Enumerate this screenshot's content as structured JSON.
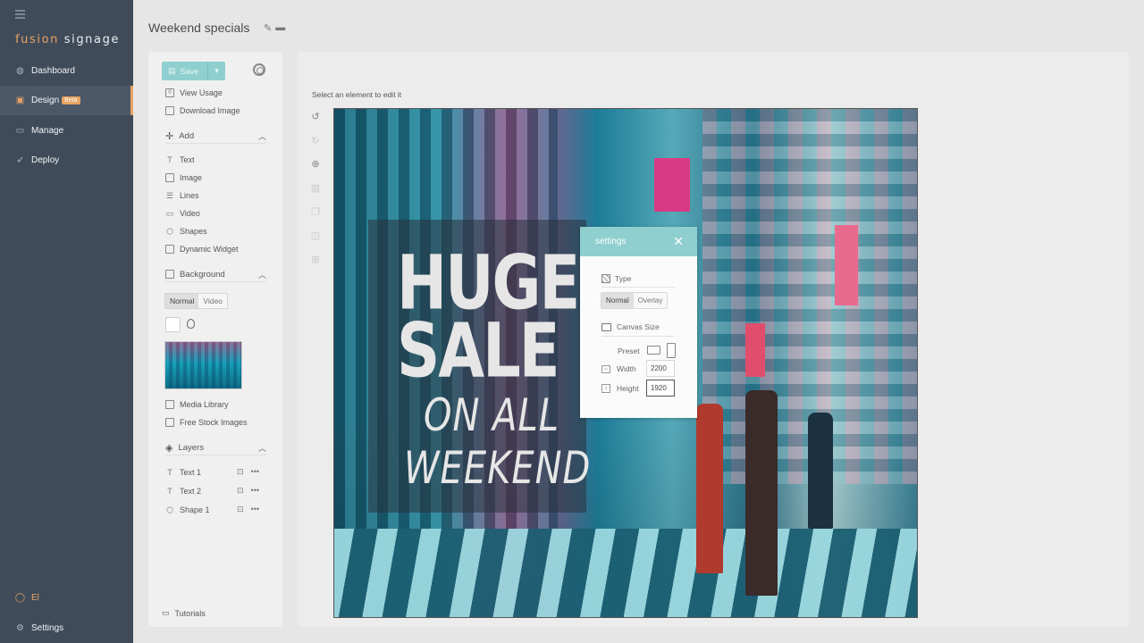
{
  "sidebar": {
    "brand_word1": "fusion",
    "brand_word2": "signage",
    "nav": [
      {
        "label": "Dashboard",
        "icon": "globe-icon"
      },
      {
        "label": "Design",
        "badge": "Beta",
        "icon": "paint-icon"
      },
      {
        "label": "Manage",
        "icon": "folder-icon"
      },
      {
        "label": "Deploy",
        "icon": "rocket-icon"
      }
    ],
    "user_label": "El",
    "settings_label": "Settings"
  },
  "header": {
    "title": "Weekend specials"
  },
  "toolbar": {
    "save_label": "Save",
    "view_usage_label": "View Usage",
    "download_image_label": "Download Image"
  },
  "add_section": {
    "title": "Add",
    "items": [
      "Text",
      "Image",
      "Lines",
      "Video",
      "Shapes",
      "Dynamic Widget"
    ]
  },
  "background_section": {
    "title": "Background",
    "modes": [
      "Normal",
      "Video"
    ],
    "active_mode": "Normal",
    "media_library_label": "Media Library",
    "free_stock_label": "Free Stock Images"
  },
  "layers_section": {
    "title": "Layers",
    "items": [
      "Text 1",
      "Text 2",
      "Shape 1"
    ]
  },
  "tutorials_label": "Tutorials",
  "canvas": {
    "hint": "Select an element to edit it",
    "headline_1": "HUGE",
    "headline_2": "SALE",
    "subline_1": "ON ALL",
    "subline_2": "WEEKEND"
  },
  "settings_dialog": {
    "title": "settings",
    "type_label": "Type",
    "type_options": [
      "Normal",
      "Overlay"
    ],
    "canvas_size_label": "Canvas Size",
    "preset_label": "Preset",
    "width_label": "Width",
    "width_value": "2200",
    "height_label": "Height",
    "height_value": "1920"
  },
  "colors": {
    "sidebar_bg": "#3f4b59",
    "accent": "#e8a462",
    "teal": "#8fcfcf"
  }
}
